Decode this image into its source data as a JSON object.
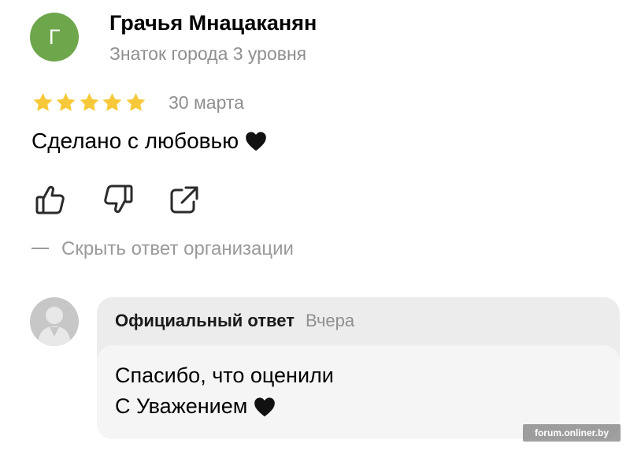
{
  "review": {
    "author_initial": "Г",
    "author_name": "Грачья Мнацаканян",
    "author_level": "Знаток города 3 уровня",
    "rating": 5,
    "rating_max": 5,
    "date": "30 марта",
    "text": "Сделано с любовью",
    "text_emoji_icon": "black-heart-icon"
  },
  "actions": {
    "like_icon": "thumbs-up-icon",
    "dislike_icon": "thumbs-down-icon",
    "share_icon": "share-icon",
    "hide_reply_label": "Скрыть ответ организации"
  },
  "org_reply": {
    "title": "Официальный ответ",
    "date": "Вчера",
    "lines": [
      "Спасибо, что оценили",
      "С Уважением"
    ],
    "line_emoji_icon": "black-heart-icon"
  },
  "watermark": "forum.onliner.by",
  "colors": {
    "avatar": "#6ea64c",
    "star": "#f7c93a",
    "muted_text": "#8f8f8f",
    "reply_header_bg": "#ececec",
    "reply_body_bg": "#f5f5f5"
  }
}
